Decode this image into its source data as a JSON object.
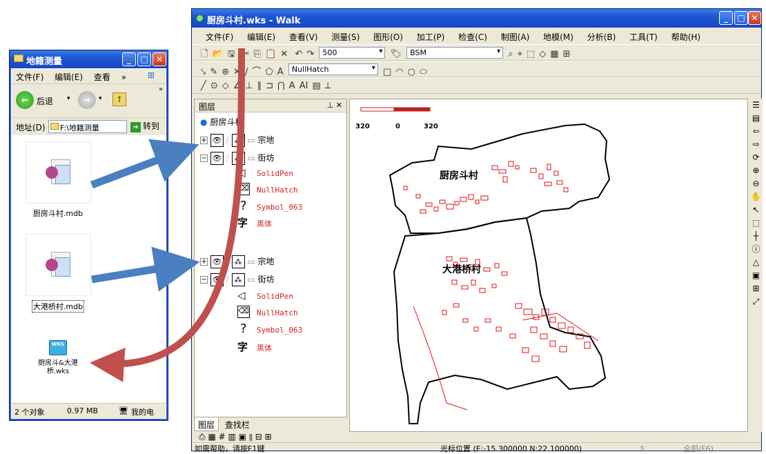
{
  "explorer": {
    "title": "地籍测量",
    "menu": [
      "文件(F)",
      "编辑(E)",
      "查看",
      "»"
    ],
    "back_label": "后退",
    "address_label": "地址(D)",
    "address_value": "F:\\地籍测量",
    "go_label": "转到",
    "files": [
      {
        "name": "厨房斗村.mdb",
        "icon": "access-database-icon"
      },
      {
        "name": "大港桥村.mdb",
        "icon": "access-database-icon"
      },
      {
        "name": "厨房斗&大港桥.wks",
        "icon": "wks-workspace-icon"
      }
    ],
    "status": {
      "count": "2 个对象",
      "size": "0.97 MB",
      "location": "我的电"
    }
  },
  "walk": {
    "title": "厨房斗村.wks - Walk",
    "menu": [
      "文件(F)",
      "编辑(E)",
      "查看(V)",
      "测量(S)",
      "图形(O)",
      "加工(P)",
      "检查(C)",
      "制图(A)",
      "地模(M)",
      "分析(B)",
      "工具(T)",
      "帮助(H)"
    ],
    "scale_value": "500",
    "field_value": "BSM",
    "hatch_value": "NullHatch",
    "layer_panel": {
      "title": "图层",
      "root": "厨房斗村",
      "groups": [
        {
          "layers": [
            "宗地",
            "街坊"
          ],
          "styles": [
            "SolidPen",
            "NullHatch",
            "Symbol_063",
            "黑体"
          ]
        },
        {
          "layers": [
            "宗地",
            "街坊"
          ],
          "styles": [
            "SolidPen",
            "NullHatch",
            "Symbol_063",
            "黑体"
          ]
        }
      ],
      "tabs": [
        "图层",
        "查找栏"
      ]
    },
    "map": {
      "scale_labels": [
        "320",
        "0",
        "320"
      ],
      "labels": [
        "厨房斗村",
        "大港桥村"
      ]
    },
    "status": {
      "help": "如需帮助，请按F1键",
      "cursor": "光标位置 (E:-15.300000 N:22.100000)",
      "mode": "s",
      "scope": "全部(F6)"
    }
  }
}
